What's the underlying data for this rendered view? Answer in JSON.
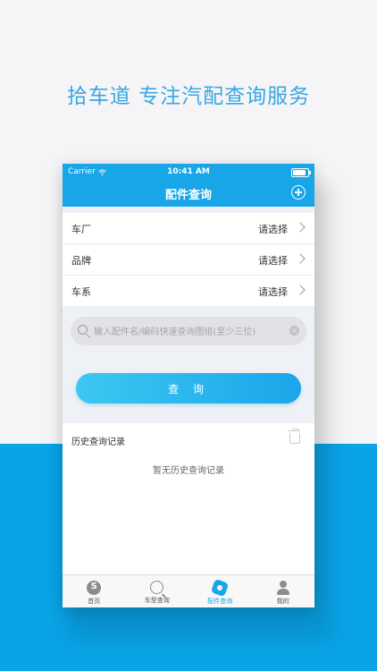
{
  "headline": "拾车道 专注汽配查询服务",
  "status_bar": {
    "carrier": "Carrier",
    "time": "10:41 AM"
  },
  "navbar": {
    "title": "配件查询"
  },
  "selects": [
    {
      "label": "车厂",
      "value": "请选择"
    },
    {
      "label": "品牌",
      "value": "请选择"
    },
    {
      "label": "车系",
      "value": "请选择"
    }
  ],
  "search": {
    "placeholder": "输入配件名/编码快速查询图组(至少三位)",
    "value": ""
  },
  "query_button": "查 询",
  "history": {
    "title": "历史查询记录",
    "empty_text": "暂无历史查询记录"
  },
  "tabs": [
    {
      "label": "首页",
      "icon": "home-icon"
    },
    {
      "label": "车型查询",
      "icon": "car-search-icon"
    },
    {
      "label": "配件查询",
      "icon": "gear-icon",
      "active": true
    },
    {
      "label": "我的",
      "icon": "user-icon"
    }
  ],
  "colors": {
    "primary": "#18a6e8",
    "background_blue": "#0aa3e6"
  }
}
